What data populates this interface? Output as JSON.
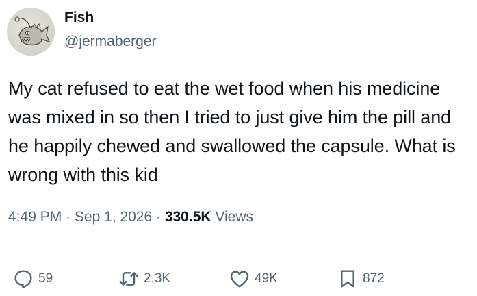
{
  "author": {
    "name": "Fish",
    "handle": "@jermaberger",
    "avatar_icon": "anglerfish-sketch-avatar"
  },
  "tweet": {
    "text": "My cat refused to eat the wet food when his medicine was mixed in so then I tried to just give him the pill and he happily chewed and swallowed the capsule. What is wrong with this kid"
  },
  "meta": {
    "time": "4:49 PM",
    "separator": " · ",
    "date": "Sep 1, 2026",
    "views_count": "330.5K",
    "views_label": "Views"
  },
  "actions": {
    "reply": {
      "icon": "reply-icon",
      "count": "59"
    },
    "retweet": {
      "icon": "retweet-icon",
      "count": "2.3K"
    },
    "like": {
      "icon": "heart-icon",
      "count": "49K"
    },
    "bookmark": {
      "icon": "bookmark-icon",
      "count": "872"
    }
  },
  "colors": {
    "text_primary": "#0f1419",
    "text_secondary": "#536471",
    "divider": "#eff3f4"
  }
}
